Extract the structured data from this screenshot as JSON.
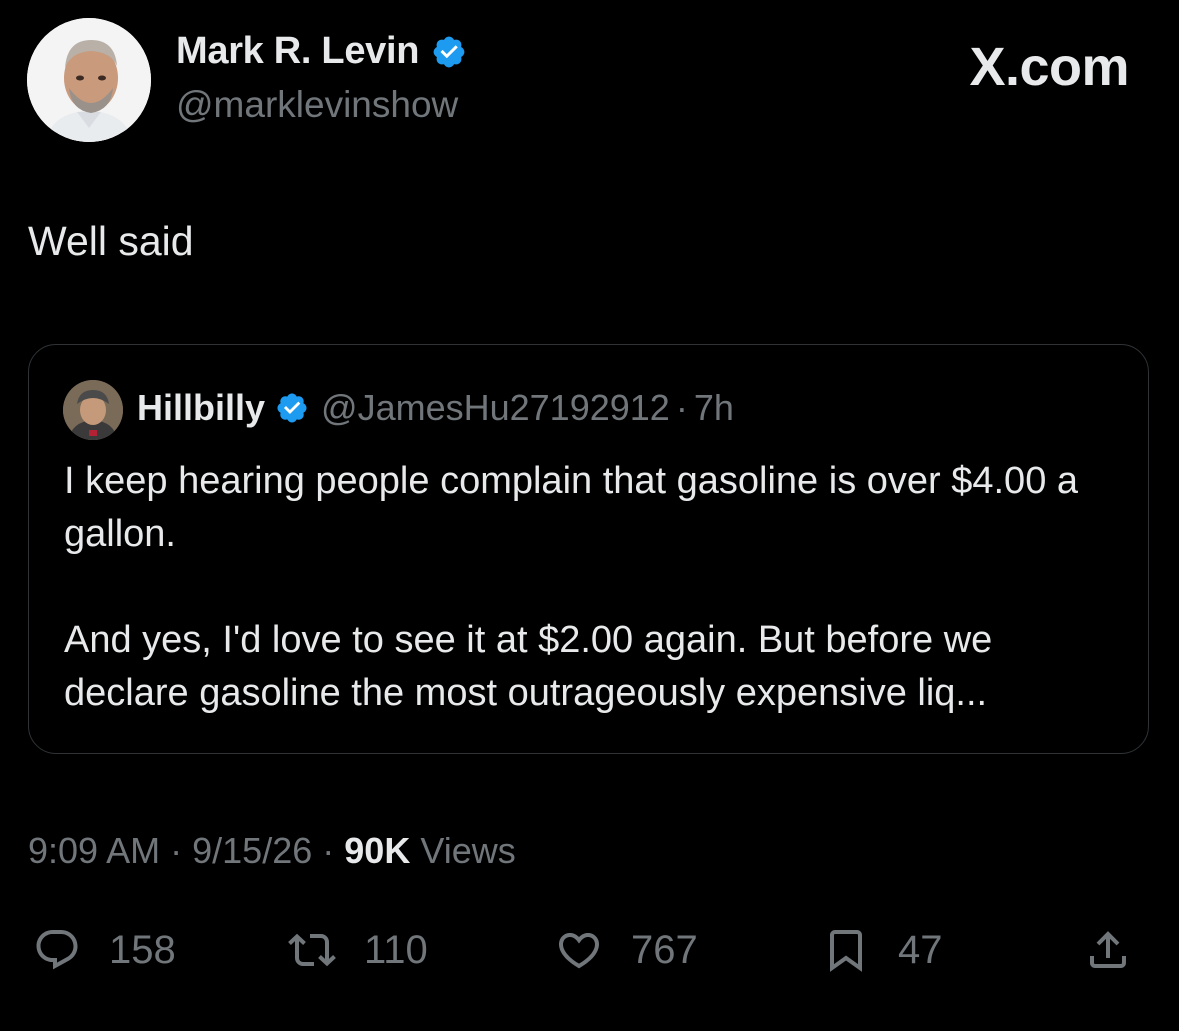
{
  "author": {
    "name": "Mark R. Levin",
    "handle": "@marklevinshow",
    "verified": true
  },
  "watermark": "X.com",
  "tweet": {
    "text": "Well said"
  },
  "quoted_tweet": {
    "name": "Hillbilly",
    "handle": "@JamesHu27192912",
    "separator": "·",
    "time": "7h",
    "verified": true,
    "paragraphs": [
      "I keep hearing people complain that gasoline is over $4.00 a gallon.",
      "And yes, I'd love to see it at $2.00 again. But before we declare gasoline the most outrageously expensive liq..."
    ]
  },
  "meta": {
    "time": "9:09 AM",
    "date": "9/15/26",
    "views_count": "90K",
    "views_label": "Views",
    "separator": "·"
  },
  "actions": {
    "replies": "158",
    "reposts": "110",
    "likes": "767",
    "bookmarks": "47"
  },
  "colors": {
    "background": "#000000",
    "text": "#e7e9ea",
    "muted": "#71767b",
    "verified_blue": "#1d9bf0",
    "border": "#2f3336"
  }
}
